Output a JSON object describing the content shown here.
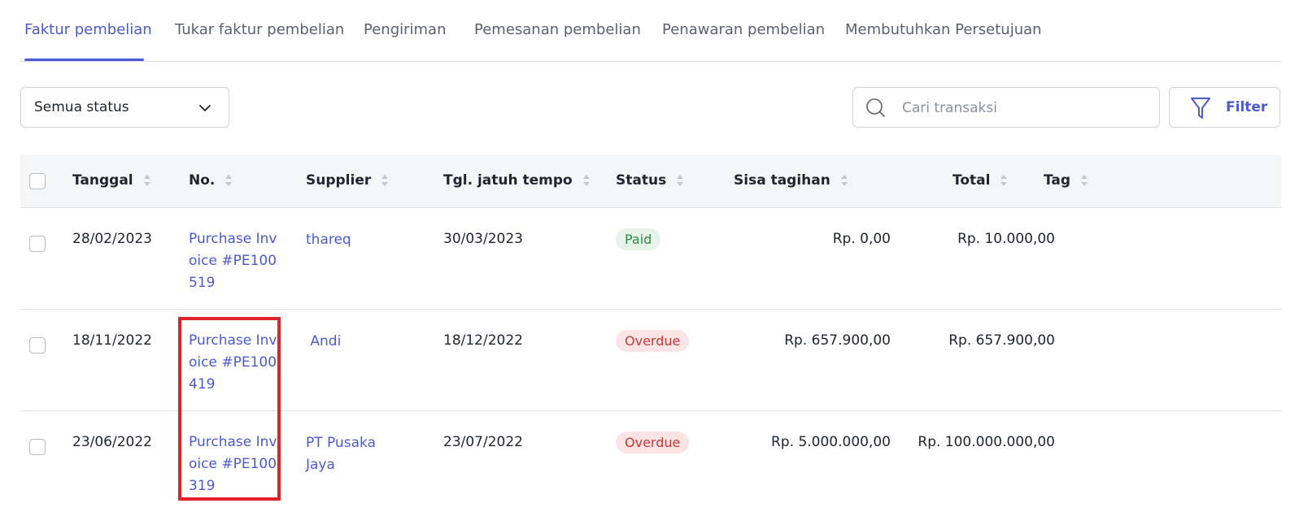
{
  "tabs": [
    {
      "label": "Faktur pembelian",
      "active": true
    },
    {
      "label": "Tukar faktur pembelian",
      "active": false
    },
    {
      "label": "Pengiriman",
      "active": false
    },
    {
      "label": "Pemesanan pembelian",
      "active": false
    },
    {
      "label": "Penawaran pembelian",
      "active": false
    },
    {
      "label": "Membutuhkan Persetujuan",
      "active": false
    }
  ],
  "toolbar": {
    "status_select": {
      "value": "Semua status"
    },
    "search": {
      "placeholder": "Cari transaksi",
      "value": ""
    },
    "filter_label": "Filter"
  },
  "table": {
    "columns": [
      "Tanggal",
      "No.",
      "Supplier",
      "Tgl. jatuh tempo",
      "Status",
      "Sisa tagihan",
      "Total",
      "Tag"
    ],
    "rows": [
      {
        "date": "28/02/2023",
        "number": "Purchase Invoice #PE100519",
        "supplier": "thareq",
        "due_date": "30/03/2023",
        "status": "Paid",
        "remaining": "Rp. 0,00",
        "total": "Rp. 10.000,00",
        "tag": ""
      },
      {
        "date": "18/11/2022",
        "number": "Purchase Invoice #PE100419",
        "supplier": " Andi",
        "due_date": "18/12/2022",
        "status": "Overdue",
        "remaining": "Rp. 657.900,00",
        "total": "Rp. 657.900,00",
        "tag": ""
      },
      {
        "date": "23/06/2022",
        "number": "Purchase Invoice #PE100319",
        "supplier": "PT Pusaka Jaya",
        "due_date": "23/07/2022",
        "status": "Overdue",
        "remaining": "Rp. 5.000.000,00",
        "total": "Rp. 100.000.000,00",
        "tag": ""
      }
    ]
  },
  "colors": {
    "accent": "#4a5ad6",
    "paid": "#2f8a45",
    "overdue": "#c53a3a",
    "highlight": "#e0222c"
  },
  "icons": {
    "dropdown": "chevron-down-icon",
    "search": "search-icon",
    "filter": "filter-icon",
    "sort": "sort-icon"
  }
}
